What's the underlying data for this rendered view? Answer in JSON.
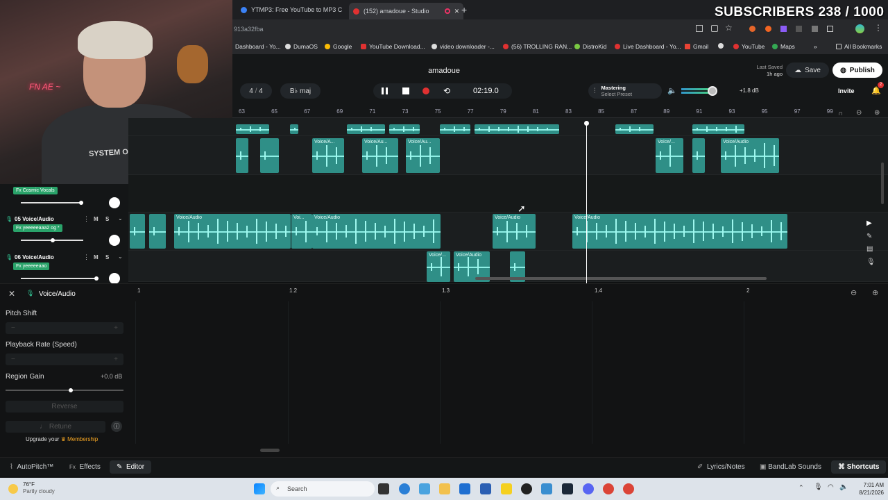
{
  "overlay": {
    "subscribers": "SUBSCRIBERS 238 / 1000"
  },
  "webcam": {
    "neon_text": "FN AE ~",
    "shirt_text": "SYSTEM OF A DOWN"
  },
  "browser": {
    "tabs": [
      {
        "label": "YTMP3: Free YouTube to MP3 C",
        "active": false
      },
      {
        "label": "(152) amadoue - Studio",
        "active": true
      }
    ],
    "url": "913a32fba",
    "bookmarks": [
      "Dashboard - Yo...",
      "DumaOS",
      "Google",
      "YouTube Download...",
      "video downloader -...",
      "(56) TROLLING RAN...",
      "DistroKid",
      "Live Dashboard - Yo...",
      "Gmail",
      "",
      "YouTube",
      "Maps"
    ],
    "all_bookmarks": "All Bookmarks"
  },
  "daw": {
    "song_title": "amadoue",
    "last_saved_label": "Last Saved",
    "last_saved_time": "1h ago",
    "save_label": "Save",
    "publish_label": "Publish",
    "time_signature_num": "4",
    "time_signature_sep": "/",
    "time_signature_den": "4",
    "key": "B♭ maj",
    "time": "02:19.0",
    "mastering_label": "Mastering",
    "mastering_preset": "Select Preset",
    "master_db": "+1.8 dB",
    "invite_label": "Invite",
    "notification_count": "2",
    "ruler": [
      "63",
      "65",
      "67",
      "69",
      "71",
      "73",
      "75",
      "77",
      "79",
      "81",
      "83",
      "85",
      "87",
      "89",
      "91",
      "93",
      "95",
      "97",
      "99"
    ]
  },
  "tracks": {
    "fx_cosmic": "Fx Cosmic Vocals",
    "t05": {
      "number": "05",
      "name": "Voice/Audio",
      "fx": "Fx yeeeeeaaa2 og *"
    },
    "t06": {
      "number": "06",
      "name": "Voice/Audio",
      "fx": "Fx yeeeeeaao"
    },
    "mute": "M",
    "solo": "S",
    "region_labels": {
      "a1": "Voice/A...",
      "a2": "Voice/Au...",
      "a3": "Voice/Au...",
      "a4": "Voice/...",
      "a5": "Voice/Audio",
      "b1": "Voice/Audio",
      "b2": "Voi...",
      "b3": "Voice/Audio",
      "b4": "Voice/Audio",
      "b5": "Voice/Audio",
      "c1": "Voice/...",
      "c2": "Voice/Audio"
    }
  },
  "editor": {
    "track_label": "Voice/Audio",
    "pitch_shift": "Pitch Shift",
    "playback_rate": "Playback Rate (Speed)",
    "region_gain": "Region Gain",
    "region_gain_value": "+0.0 dB",
    "region_gain_level": 0.55,
    "reverse": "Reverse",
    "retune": "Retune",
    "upgrade_prefix": "Upgrade your",
    "upgrade_link": "Membership",
    "ruler": [
      "1",
      "1.2",
      "1.3",
      "1.4",
      "2"
    ]
  },
  "bottom": {
    "autopitch": "AutoPitch™",
    "effects": "Effects",
    "editor": "Editor",
    "lyrics": "Lyrics/Notes",
    "sounds": "BandLab Sounds",
    "shortcuts": "Shortcuts"
  },
  "taskbar": {
    "weather_temp": "76°F",
    "weather_desc": "Partly cloudy",
    "search": "Search",
    "time": "7:01 AM",
    "date": "8/21/2026"
  },
  "colors": {
    "region": "#2f8f87",
    "accent_green": "#2aa36a",
    "record": "#e03131",
    "membership": "#f5a623"
  }
}
